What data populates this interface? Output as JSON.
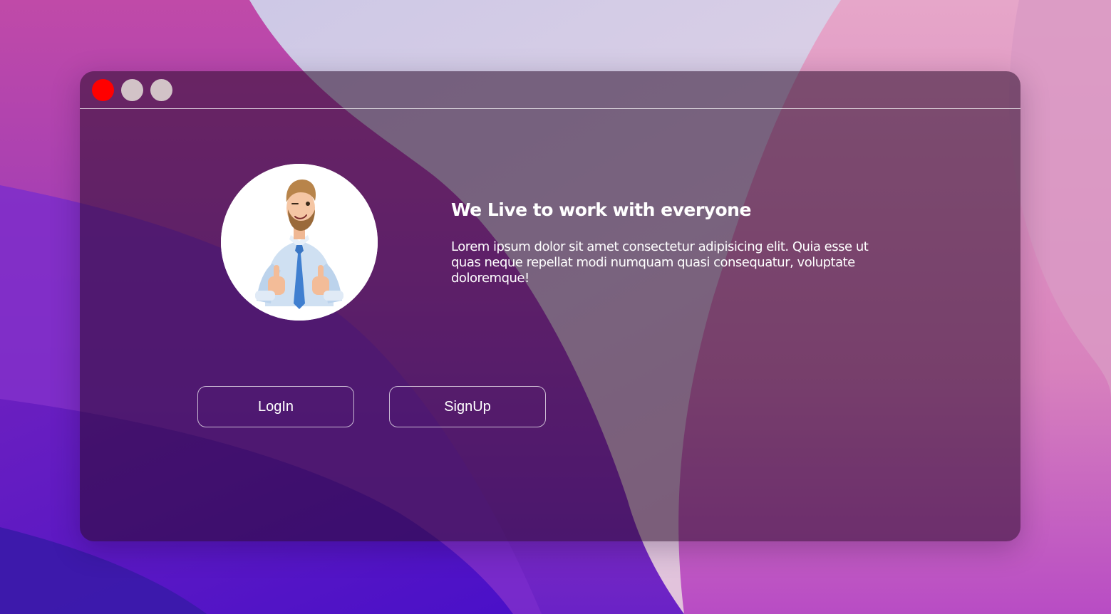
{
  "colors": {
    "close_dot": "#ff0000",
    "minimize_dot": "#d2c3c7",
    "maximize_dot": "#d2c3c7",
    "text": "#ffffff",
    "window_tint": "rgba(40,10,40,0.55)"
  },
  "window": {
    "controls": [
      {
        "name": "close",
        "icon": "close-dot"
      },
      {
        "name": "minimize",
        "icon": "minimize-dot"
      },
      {
        "name": "maximize",
        "icon": "maximize-dot"
      }
    ]
  },
  "hero": {
    "avatar_icon": "thumbs-up-man-illustration",
    "headline": "We Live to work with everyone",
    "body": "Lorem ipsum dolor sit amet consectetur adipisicing elit. Quia esse ut quas neque repellat modi numquam quasi consequatur, voluptate doloremque!"
  },
  "buttons": {
    "login_label": "LogIn",
    "signup_label": "SignUp"
  }
}
